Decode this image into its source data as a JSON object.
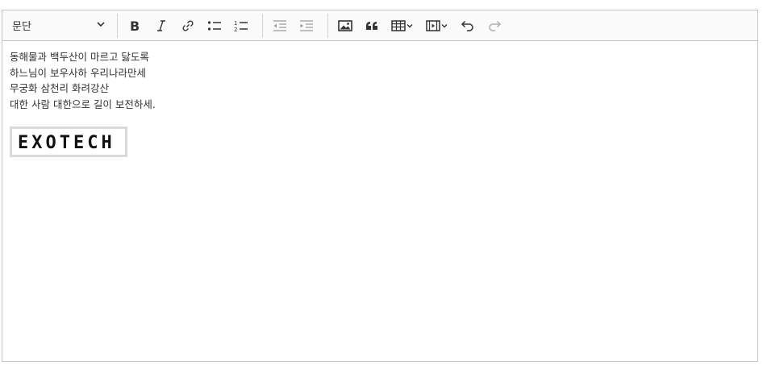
{
  "toolbar": {
    "heading_dropdown": {
      "value": "문단",
      "icon": "chevron-down-icon"
    },
    "buttons": [
      {
        "name": "bold",
        "icon": "bold-icon"
      },
      {
        "name": "italic",
        "icon": "italic-icon"
      },
      {
        "name": "link",
        "icon": "link-icon"
      },
      {
        "name": "bulleted-list",
        "icon": "bulleted-list-icon"
      },
      {
        "name": "numbered-list",
        "icon": "numbered-list-icon"
      },
      {
        "name": "outdent",
        "icon": "outdent-icon"
      },
      {
        "name": "indent",
        "icon": "indent-icon"
      },
      {
        "name": "insert-image",
        "icon": "image-icon"
      },
      {
        "name": "block-quote",
        "icon": "quote-icon"
      },
      {
        "name": "insert-table",
        "icon": "table-icon"
      },
      {
        "name": "insert-media",
        "icon": "media-icon"
      },
      {
        "name": "undo",
        "icon": "undo-icon"
      },
      {
        "name": "redo",
        "icon": "redo-icon",
        "disabled": true
      }
    ]
  },
  "content": {
    "lines": [
      "동해물과 백두산이 마르고 닳도록",
      "하느님이 보우사하 우리나라만세",
      "무궁화 삼천리 화려강산",
      "대한 사람 대한으로 길이 보전하세."
    ],
    "image": {
      "logo_text": "EXOTECH"
    }
  },
  "colors": {
    "toolbar_bg": "#fafafa",
    "border": "#c4c4c4",
    "text": "#333333",
    "disabled": "#b0b0b0"
  }
}
